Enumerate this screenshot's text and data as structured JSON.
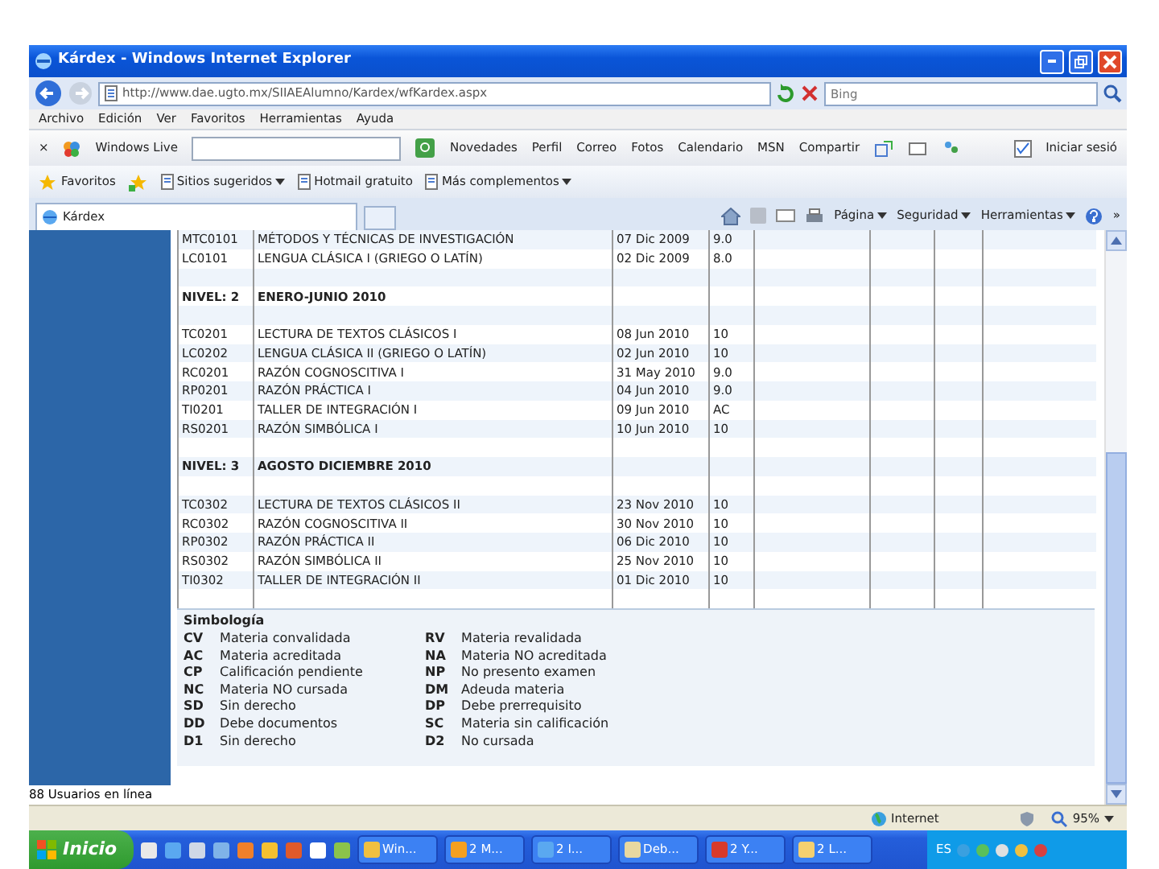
{
  "window": {
    "title": "Kárdex - Windows Internet Explorer"
  },
  "address_bar": {
    "url": "http://www.dae.ugto.mx/SIIAEAlumno/Kardex/wfKardex.aspx",
    "search_placeholder": "Bing"
  },
  "menu": [
    "Archivo",
    "Edición",
    "Ver",
    "Favoritos",
    "Herramientas",
    "Ayuda"
  ],
  "live_toolbar": {
    "close": "×",
    "brand": "Windows Live",
    "links": [
      "Novedades",
      "Perfil",
      "Correo",
      "Fotos",
      "Calendario",
      "MSN",
      "Compartir"
    ],
    "signin": "Iniciar sesió"
  },
  "favorites_bar": {
    "favorites": "Favoritos",
    "items": [
      {
        "label": "Sitios sugeridos",
        "dropdown": true
      },
      {
        "label": "Hotmail gratuito",
        "dropdown": false
      },
      {
        "label": "Más complementos",
        "dropdown": true
      }
    ]
  },
  "tabs": [
    {
      "label": "Kárdex",
      "selected": true
    }
  ],
  "command_bar": {
    "items": [
      "Página",
      "Seguridad",
      "Herramientas"
    ],
    "more": "»"
  },
  "kardex": {
    "rows": [
      {
        "kind": "course",
        "code": "MTC0101",
        "name": "MÉTODOS Y TÉCNICAS DE INVESTIGACIÓN",
        "date": "07 Dic 2009",
        "grade": "9.0"
      },
      {
        "kind": "course",
        "code": "LC0101",
        "name": "LENGUA CLÁSICA I (GRIEGO O LATÍN)",
        "date": "02 Dic 2009",
        "grade": "8.0"
      },
      {
        "kind": "blank"
      },
      {
        "kind": "level",
        "code": "NIVEL: 2",
        "name": "ENERO-JUNIO 2010"
      },
      {
        "kind": "blank"
      },
      {
        "kind": "course",
        "code": "TC0201",
        "name": "LECTURA DE TEXTOS CLÁSICOS I",
        "date": "08 Jun 2010",
        "grade": "10"
      },
      {
        "kind": "course",
        "code": "LC0202",
        "name": "LENGUA CLÁSICA II (GRIEGO O LATÍN)",
        "date": "02 Jun 2010",
        "grade": "10"
      },
      {
        "kind": "course",
        "code": "RC0201",
        "name": "RAZÓN COGNOSCITIVA I",
        "date": "31 May 2010",
        "grade": "9.0"
      },
      {
        "kind": "course",
        "code": "RP0201",
        "name": "RAZÓN PRÁCTICA I",
        "date": "04 Jun 2010",
        "grade": "9.0"
      },
      {
        "kind": "course",
        "code": "TI0201",
        "name": "TALLER DE INTEGRACIÓN I",
        "date": "09 Jun 2010",
        "grade": "AC"
      },
      {
        "kind": "course",
        "code": "RS0201",
        "name": "RAZÓN SIMBÓLICA I",
        "date": "10 Jun 2010",
        "grade": "10"
      },
      {
        "kind": "blank"
      },
      {
        "kind": "level",
        "code": "NIVEL: 3",
        "name": "AGOSTO DICIEMBRE 2010"
      },
      {
        "kind": "blank"
      },
      {
        "kind": "course",
        "code": "TC0302",
        "name": "LECTURA DE TEXTOS CLÁSICOS II",
        "date": "23 Nov 2010",
        "grade": "10"
      },
      {
        "kind": "course",
        "code": "RC0302",
        "name": "RAZÓN COGNOSCITIVA II",
        "date": "30 Nov 2010",
        "grade": "10"
      },
      {
        "kind": "course",
        "code": "RP0302",
        "name": "RAZÓN PRÁCTICA II",
        "date": "06 Dic 2010",
        "grade": "10"
      },
      {
        "kind": "course",
        "code": "RS0302",
        "name": "RAZÓN SIMBÓLICA II",
        "date": "25 Nov 2010",
        "grade": "10"
      },
      {
        "kind": "course",
        "code": "TI0302",
        "name": "TALLER DE INTEGRACIÓN II",
        "date": "01 Dic 2010",
        "grade": "10"
      },
      {
        "kind": "blank"
      }
    ]
  },
  "legend": {
    "title": "Simbología",
    "items": [
      {
        "code": "CV",
        "meaning": "Materia convalidada"
      },
      {
        "code": "RV",
        "meaning": "Materia revalidada"
      },
      {
        "code": "AC",
        "meaning": "Materia acreditada"
      },
      {
        "code": "NA",
        "meaning": "Materia NO acreditada"
      },
      {
        "code": "CP",
        "meaning": "Calificación pendiente"
      },
      {
        "code": "NP",
        "meaning": "No presento examen"
      },
      {
        "code": "NC",
        "meaning": "Materia NO cursada"
      },
      {
        "code": "DM",
        "meaning": "Adeuda materia"
      },
      {
        "code": "SD",
        "meaning": "Sin derecho"
      },
      {
        "code": "DP",
        "meaning": "Debe prerrequisito"
      },
      {
        "code": "DD",
        "meaning": "Debe documentos"
      },
      {
        "code": "SC",
        "meaning": "Materia sin calificación"
      },
      {
        "code": "D1",
        "meaning": "Sin derecho"
      },
      {
        "code": "D2",
        "meaning": "No cursada"
      }
    ]
  },
  "users_online": "88 Usuarios en línea",
  "status_bar": {
    "zone": "Internet",
    "zoom": "95%"
  },
  "taskbar": {
    "start": "Inicio",
    "tasks": [
      "Win...",
      "2 M...",
      "2 I...",
      "Deb...",
      "2 Y...",
      "2 L..."
    ],
    "language": "ES"
  }
}
